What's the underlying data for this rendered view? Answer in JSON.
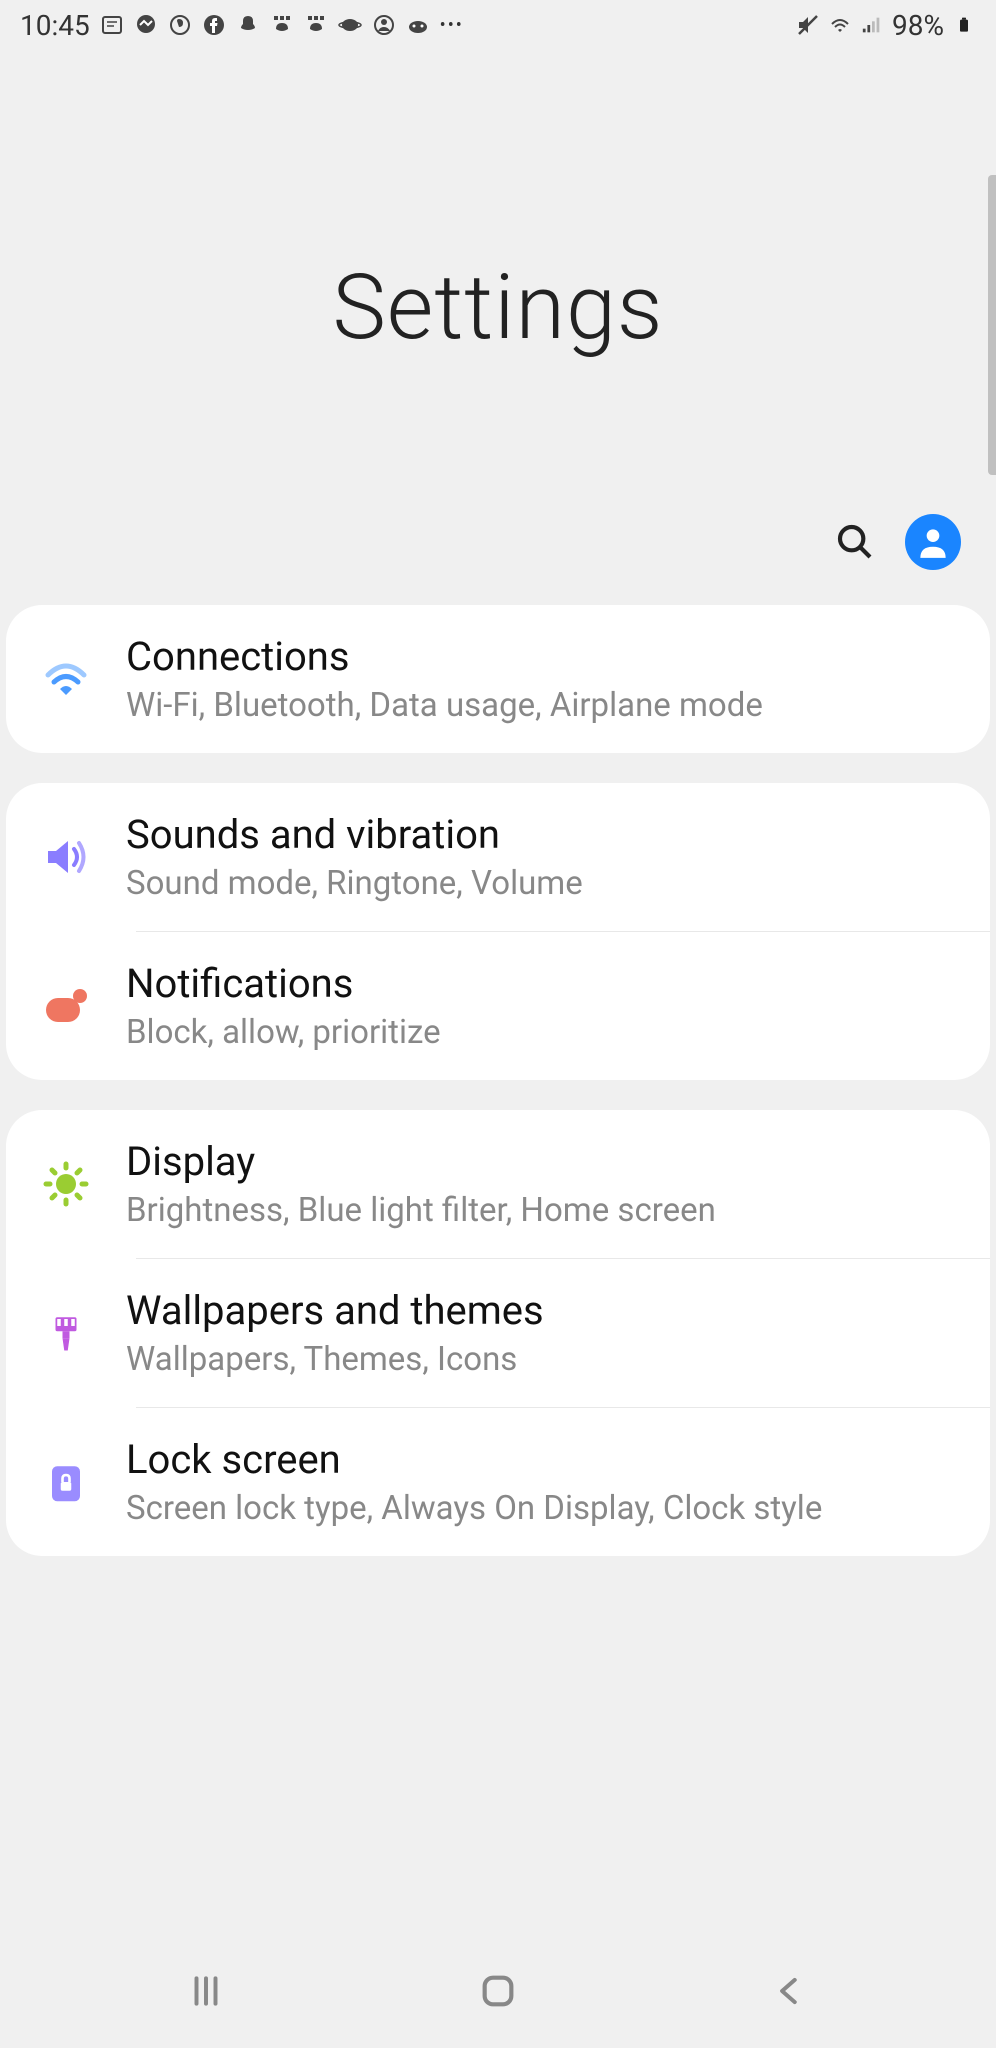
{
  "statusBar": {
    "time": "10:45",
    "battery": "98%"
  },
  "header": {
    "title": "Settings"
  },
  "settings": {
    "connections": {
      "title": "Connections",
      "subtitle": "Wi-Fi, Bluetooth, Data usage, Airplane mode"
    },
    "sounds": {
      "title": "Sounds and vibration",
      "subtitle": "Sound mode, Ringtone, Volume"
    },
    "notifications": {
      "title": "Notifications",
      "subtitle": "Block, allow, prioritize"
    },
    "display": {
      "title": "Display",
      "subtitle": "Brightness, Blue light filter, Home screen"
    },
    "wallpapers": {
      "title": "Wallpapers and themes",
      "subtitle": "Wallpapers, Themes, Icons"
    },
    "lockscreen": {
      "title": "Lock screen",
      "subtitle": "Screen lock type, Always On Display, Clock style"
    }
  }
}
